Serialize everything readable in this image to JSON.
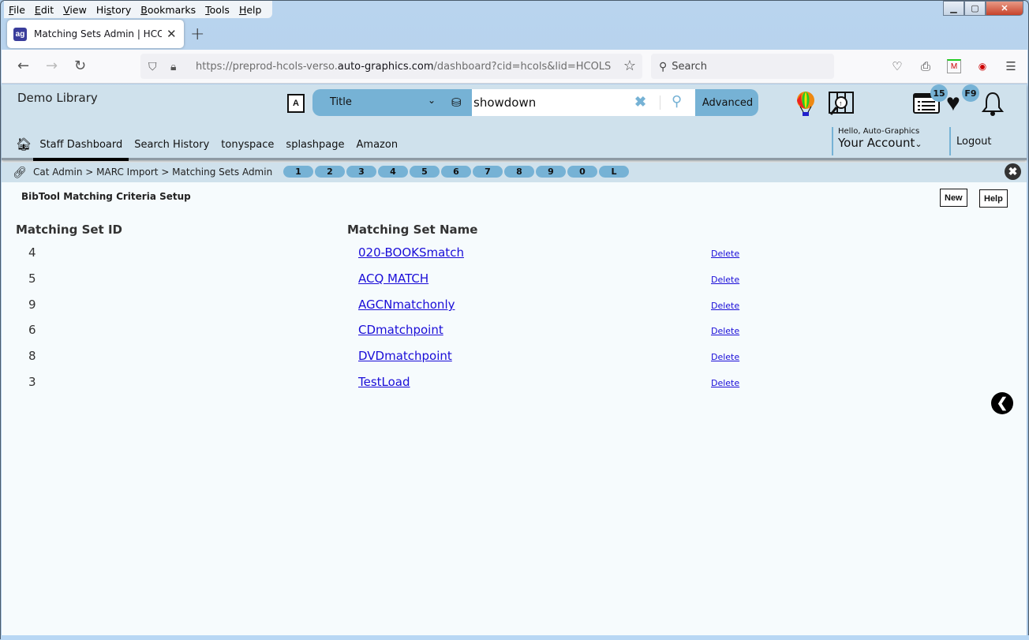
{
  "browser": {
    "menu": [
      "File",
      "Edit",
      "View",
      "History",
      "Bookmarks",
      "Tools",
      "Help"
    ],
    "menu_mnemonics": [
      "F",
      "E",
      "V",
      "s",
      "B",
      "T",
      "H"
    ],
    "tab_title": "Matching Sets Admin | HCOLS",
    "url_prefix": "https://preprod-hcols-verso.",
    "url_domain": "auto-graphics.com",
    "url_suffix": "/dashboard?cid=hcols&lid=HCOLS",
    "search_placeholder": "Search",
    "window_controls": {
      "minimize": "▭",
      "maximize": "▢",
      "close": "✕"
    }
  },
  "header": {
    "library_name": "Demo Library",
    "search": {
      "type_selected": "Title",
      "query": "showdown",
      "advanced_label": "Advanced"
    },
    "badges": {
      "list_count": "15",
      "favorites": "F9"
    },
    "nav": [
      {
        "label": "Staff Dashboard",
        "active": true
      },
      {
        "label": "Search History"
      },
      {
        "label": "tonyspace"
      },
      {
        "label": "splashpage"
      },
      {
        "label": "Amazon"
      }
    ],
    "account": {
      "hello": "Hello, Auto-Graphics",
      "label": "Your Account"
    },
    "logout": "Logout"
  },
  "breadcrumb": {
    "text": "Cat Admin > MARC Import > Matching Sets Admin",
    "pills": [
      "1",
      "2",
      "3",
      "4",
      "5",
      "6",
      "7",
      "8",
      "9",
      "0",
      "L"
    ]
  },
  "main": {
    "title": "BibTool Matching Criteria Setup",
    "new_label": "New",
    "help_label": "Help",
    "columns": [
      "Matching Set ID",
      "Matching Set Name"
    ],
    "delete_label": "Delete",
    "rows": [
      {
        "id": "4",
        "name": "020-BOOKSmatch"
      },
      {
        "id": "5",
        "name": "ACQ MATCH"
      },
      {
        "id": "9",
        "name": "AGCNmatchonly"
      },
      {
        "id": "6",
        "name": "CDmatchpoint"
      },
      {
        "id": "8",
        "name": "DVDmatchpoint"
      },
      {
        "id": "3",
        "name": "TestLoad"
      }
    ]
  }
}
